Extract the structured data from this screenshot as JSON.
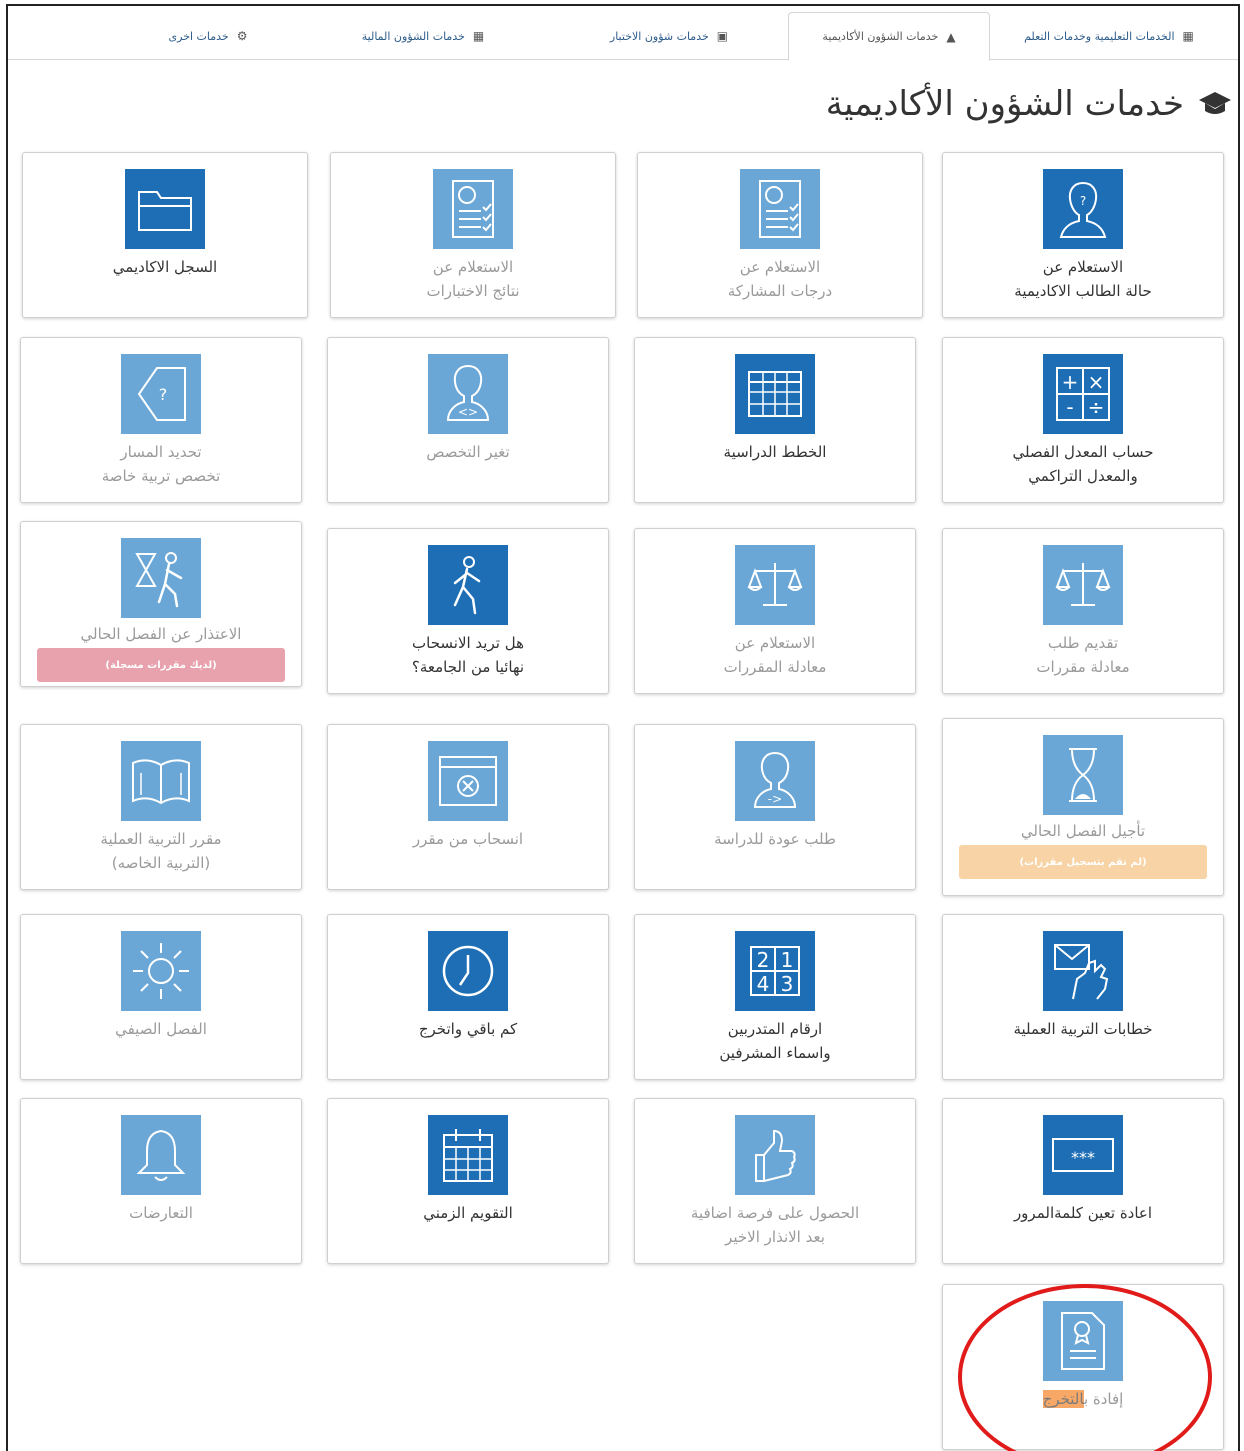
{
  "tabs": [
    {
      "label": "الخدمات التعليمية وخدمات التعلم",
      "icon": "clipboard-icon",
      "active": false
    },
    {
      "label": "خدمات الشؤون الأكاديمية",
      "icon": "graduation-cap-icon",
      "active": true
    },
    {
      "label": "خدمات شؤون الاختبار",
      "icon": "calendar-icon",
      "active": false
    },
    {
      "label": "خدمات الشؤون المالية",
      "icon": "money-icon",
      "active": false
    },
    {
      "label": "خدمات اخرى",
      "icon": "gear-icon",
      "active": false
    }
  ],
  "page_title": "خدمات الشؤون الأكاديمية",
  "cards": [
    {
      "l1": "الاستعلام عن",
      "l2": "حالة الطالب الاكاديمية",
      "icon": "student-head-icon"
    },
    {
      "l1": "الاستعلام عن",
      "l2": "درجات المشاركة",
      "icon": "checklist-icon"
    },
    {
      "l1": "الاستعلام عن",
      "l2": "نتائج الاختبارات",
      "icon": "checklist-icon"
    },
    {
      "l1": "السجل الاكاديمي",
      "l2": "",
      "icon": "folder-icon"
    },
    {
      "l1": "حساب المعدل الفصلي",
      "l2": "والمعدل التراكمي",
      "icon": "calculator-icon"
    },
    {
      "l1": "الخطط الدراسية",
      "l2": "",
      "icon": "table-grid-icon"
    },
    {
      "l1": "تغير التخصص",
      "l2": "",
      "icon": "head-code-icon"
    },
    {
      "l1": "تحديد المسار",
      "l2": "تخصص تربية خاصة",
      "icon": "direction-arrow-icon"
    },
    {
      "l1": "تقديم طلب",
      "l2": "معادلة مقررات",
      "icon": "scale-icon"
    },
    {
      "l1": "الاستعلام عن",
      "l2": "معادلة المقررات",
      "icon": "scale-icon"
    },
    {
      "l1": "هل تريد الانسحاب",
      "l2": "نهائيا من الجامعة؟",
      "icon": "walking-person-icon"
    },
    {
      "l1": "الاعتذار عن الفصل الحالي",
      "l2": "",
      "icon": "hourglass-person-icon",
      "badge": "(لديك مقررات مسجلة)"
    },
    {
      "l1": "تأجيل الفصل الحالي",
      "l2": "",
      "icon": "hourglass-icon",
      "badge": "(لم تقم بتسجيل مقررات)"
    },
    {
      "l1": "طلب عودة للدراسة",
      "l2": "",
      "icon": "head-back-icon"
    },
    {
      "l1": "انسحاب من مقرر",
      "l2": "",
      "icon": "window-close-icon"
    },
    {
      "l1": "مقرر التربية العملية",
      "l2": "(التربية الخاصه)",
      "icon": "book-icon"
    },
    {
      "l1": "خطابات التربية العملية",
      "l2": "",
      "icon": "envelope-hand-icon"
    },
    {
      "l1": "ارقام المتدربين",
      "l2": "واسماء المشرفين",
      "icon": "numbers-grid-icon",
      "nums": [
        "2",
        "1",
        "4",
        "3"
      ]
    },
    {
      "l1": "كم باقي واتخرج",
      "l2": "",
      "icon": "clock-icon"
    },
    {
      "l1": "الفصل الصيفي",
      "l2": "",
      "icon": "sun-icon"
    },
    {
      "l1": "اعادة تعين كلمةالمرور",
      "l2": "",
      "icon": "password-field-icon",
      "stars": "***"
    },
    {
      "l1": "الحصول على فرصة اضافية",
      "l2": "بعد الانذار الاخير",
      "icon": "thumbs-up-icon"
    },
    {
      "l1": "التقويم الزمني",
      "l2": "",
      "icon": "calendar-icon"
    },
    {
      "l1": "التعارضات",
      "l2": "",
      "icon": "bell-icon"
    },
    {
      "l1a": "إفادة ب",
      "l1b": "التخرج",
      "icon": "certificate-icon"
    }
  ],
  "colors": {
    "icon_light": "#6aa7d6",
    "icon_dark": "#1e6eb5",
    "circle": "#e11a1a",
    "tab_text": "#2c5b8a"
  }
}
